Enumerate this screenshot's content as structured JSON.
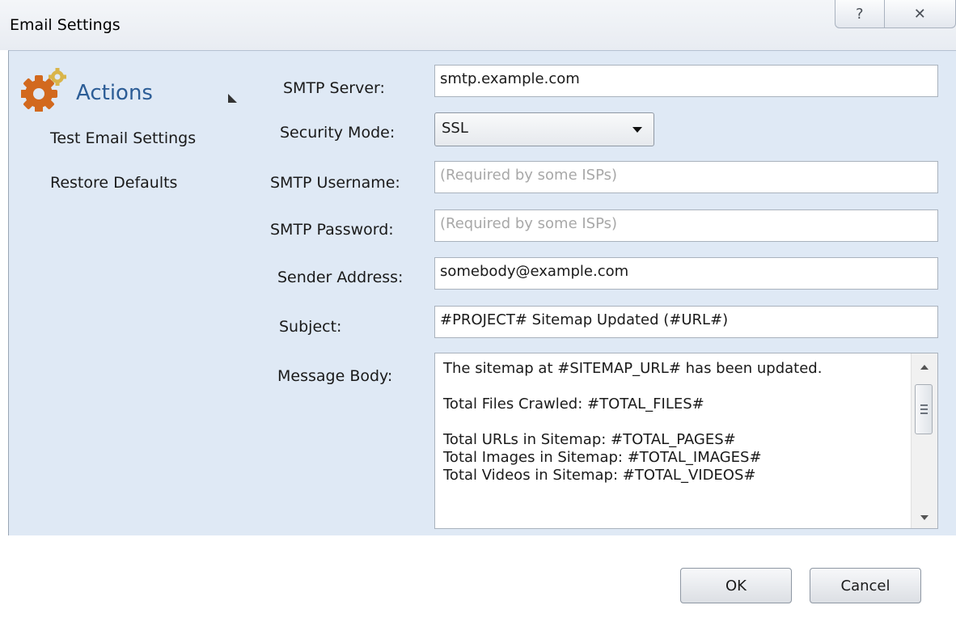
{
  "window": {
    "title": "Email Settings",
    "help_icon": "help-icon",
    "close_icon": "close-icon",
    "help_glyph": "?",
    "close_glyph": "✕"
  },
  "actions": {
    "title": "Actions",
    "icon": "gear-icon",
    "accent_color": "#2c5d96",
    "items": [
      {
        "label": "Test Email Settings"
      },
      {
        "label": "Restore Defaults"
      }
    ]
  },
  "form": {
    "smtp_server": {
      "label": "SMTP Server:",
      "value": "smtp.example.com"
    },
    "security_mode": {
      "label": "Security Mode:",
      "value": "SSL"
    },
    "smtp_username": {
      "label": "SMTP Username:",
      "value": "",
      "placeholder": "(Required by some ISPs)"
    },
    "smtp_password": {
      "label": "SMTP Password:",
      "value": "",
      "placeholder": "(Required by some ISPs)"
    },
    "sender_address": {
      "label": "Sender Address:",
      "value": "somebody@example.com"
    },
    "subject": {
      "label": "Subject:",
      "value": "#PROJECT# Sitemap Updated (#URL#)"
    },
    "message_body": {
      "label": "Message Body:",
      "value": "The sitemap at #SITEMAP_URL# has been updated.\n\nTotal Files Crawled: #TOTAL_FILES#\n\nTotal URLs in Sitemap: #TOTAL_PAGES#\nTotal Images in Sitemap: #TOTAL_IMAGES#\nTotal Videos in Sitemap: #TOTAL_VIDEOS#"
    }
  },
  "buttons": {
    "ok": "OK",
    "cancel": "Cancel"
  }
}
